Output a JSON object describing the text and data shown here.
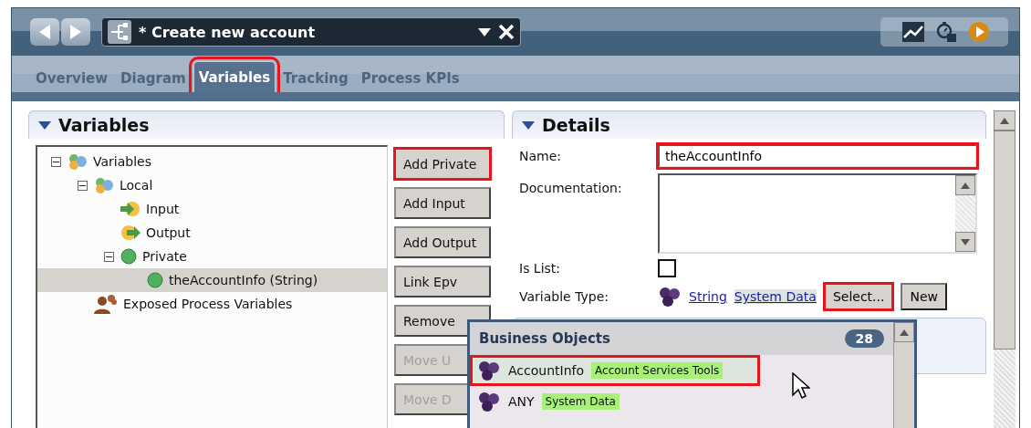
{
  "header": {
    "title": "* Create new account"
  },
  "tabs": [
    {
      "label": "Overview",
      "selected": false,
      "highlighted": false
    },
    {
      "label": "Diagram",
      "selected": false,
      "highlighted": false
    },
    {
      "label": "Variables",
      "selected": true,
      "highlighted": true
    },
    {
      "label": "Tracking",
      "selected": false,
      "highlighted": false
    },
    {
      "label": "Process KPIs",
      "selected": false,
      "highlighted": false
    }
  ],
  "variables_panel": {
    "title": "Variables",
    "tree": [
      {
        "label": "Variables",
        "kind": "group",
        "expanded": true,
        "selected": false,
        "children": [
          {
            "label": "Local",
            "kind": "group",
            "expanded": true,
            "selected": false,
            "children": [
              {
                "label": "Input",
                "kind": "input",
                "selected": false
              },
              {
                "label": "Output",
                "kind": "output",
                "selected": false
              },
              {
                "label": "Private",
                "kind": "private",
                "expanded": true,
                "selected": false,
                "children": [
                  {
                    "label": "theAccountInfo (String)",
                    "kind": "private",
                    "selected": true
                  }
                ]
              }
            ]
          },
          {
            "label": "Exposed Process Variables",
            "kind": "exposed",
            "selected": false
          }
        ]
      }
    ]
  },
  "buttons": [
    {
      "label": "Add Private",
      "disabled": false,
      "highlighted": true
    },
    {
      "label": "Add Input",
      "disabled": false,
      "highlighted": false
    },
    {
      "label": "Add Output",
      "disabled": false,
      "highlighted": false
    },
    {
      "label": "Link Epv",
      "disabled": false,
      "highlighted": false
    },
    {
      "label": "Remove",
      "disabled": false,
      "highlighted": false
    },
    {
      "label": "Move U",
      "disabled": true,
      "highlighted": false
    },
    {
      "label": "Move D",
      "disabled": true,
      "highlighted": false
    }
  ],
  "details": {
    "title": "Details",
    "name_label": "Name:",
    "name_value": "theAccountInfo",
    "name_highlighted": true,
    "documentation_label": "Documentation:",
    "is_list_label": "Is List:",
    "is_list": false,
    "variable_type_label": "Variable Type:",
    "type_link": "String",
    "type_source": "System Data",
    "select_button": "Select...",
    "select_highlighted": true,
    "new_button": "New"
  },
  "popup": {
    "title": "Business Objects",
    "count": "28",
    "items": [
      {
        "name": "AccountInfo",
        "tag": "Account Services Tools",
        "selected": true,
        "highlighted": true
      },
      {
        "name": "ANY",
        "tag": "System Data",
        "selected": false,
        "highlighted": false
      }
    ]
  }
}
